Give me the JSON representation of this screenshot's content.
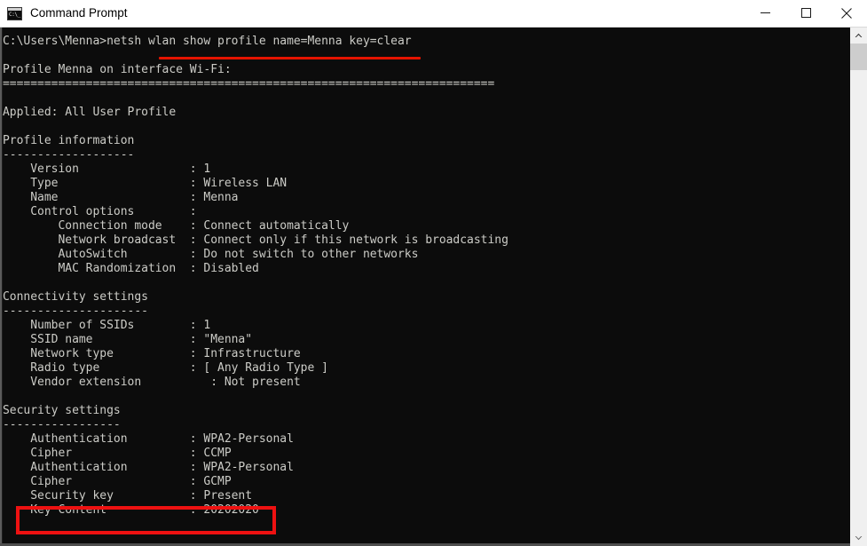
{
  "window": {
    "title": "Command Prompt",
    "app_icon": "command-prompt-icon",
    "icon_prompt_text": "C:\\_",
    "background_color": "#0c0c0c",
    "text_color": "#ccccc7"
  },
  "titlebar": {
    "minimize_label": "Minimize",
    "maximize_label": "Maximize",
    "close_label": "Close"
  },
  "scrollbar": {
    "up_arrow_label": "Scroll up",
    "down_arrow_label": "Scroll down",
    "thumb_label": "Scroll thumb"
  },
  "terminal": {
    "prompt": "C:\\Users\\Menna>",
    "command": "netsh wlan show profile name=Menna key=clear",
    "lines": [
      "C:\\Users\\Menna>netsh wlan show profile name=Menna key=clear",
      "",
      "Profile Menna on interface Wi-Fi:",
      "=======================================================================",
      "",
      "Applied: All User Profile",
      "",
      "Profile information",
      "-------------------",
      "    Version                : 1",
      "    Type                   : Wireless LAN",
      "    Name                   : Menna",
      "    Control options        :",
      "        Connection mode    : Connect automatically",
      "        Network broadcast  : Connect only if this network is broadcasting",
      "        AutoSwitch         : Do not switch to other networks",
      "        MAC Randomization  : Disabled",
      "",
      "Connectivity settings",
      "---------------------",
      "    Number of SSIDs        : 1",
      "    SSID name              : \"Menna\"",
      "    Network type           : Infrastructure",
      "    Radio type             : [ Any Radio Type ]",
      "    Vendor extension          : Not present",
      "",
      "Security settings",
      "-----------------",
      "    Authentication         : WPA2-Personal",
      "    Cipher                 : CCMP",
      "    Authentication         : WPA2-Personal",
      "    Cipher                 : GCMP",
      "    Security key           : Present",
      "    Key Content            : 20202020"
    ]
  },
  "annotations": {
    "accent_color": "#ee1111",
    "underline": {
      "label": "command-underline",
      "target_text": "netsh wlan show profile name=Menna key=clear"
    },
    "highlight_box": {
      "label": "key-content-highlight",
      "target_text": "Key Content            : 20202020"
    }
  }
}
